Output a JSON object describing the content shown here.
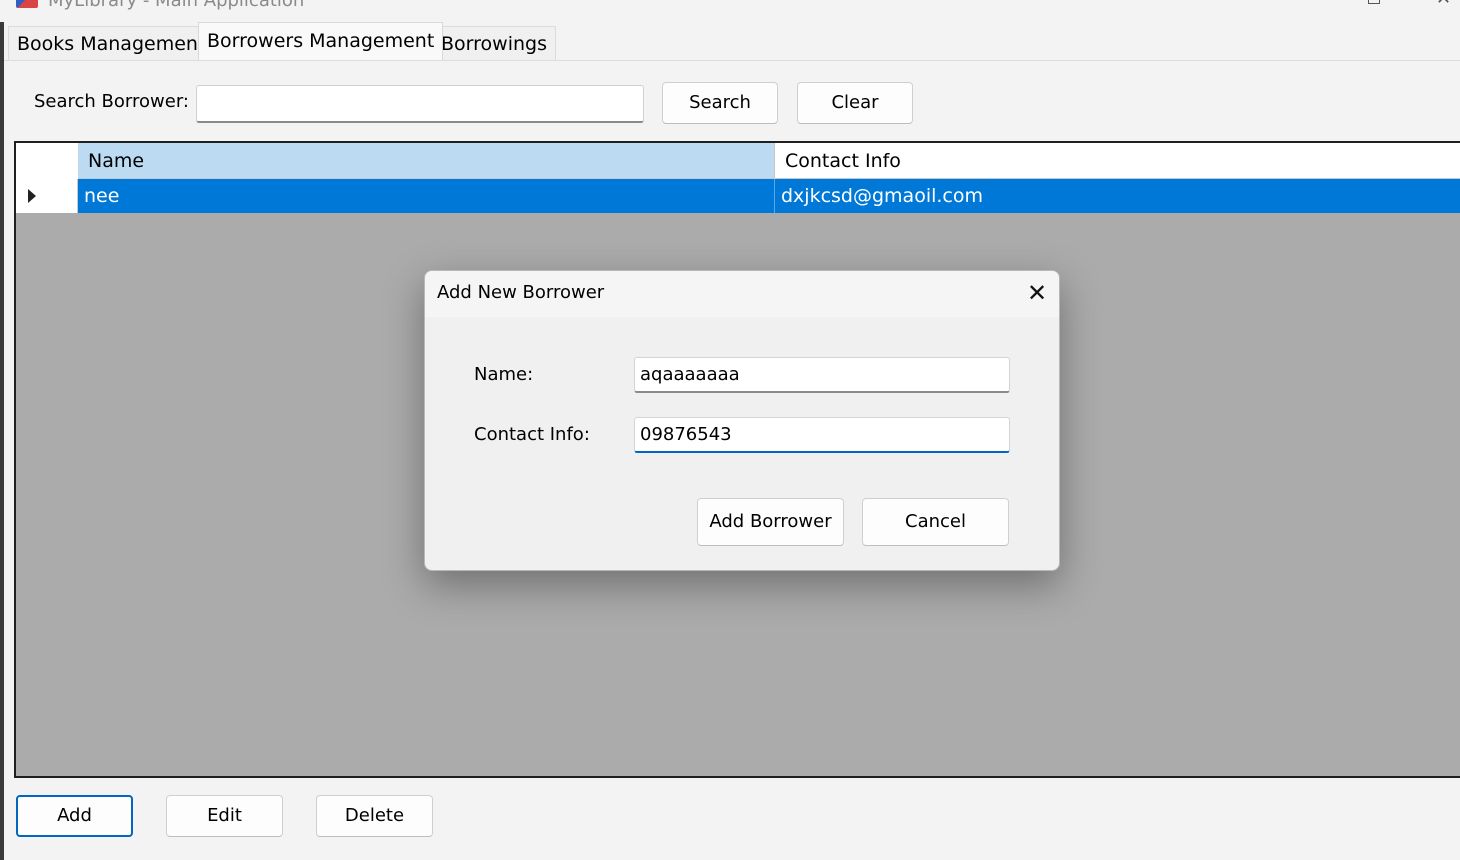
{
  "window": {
    "title": "MyLibrary - Main Application"
  },
  "tabs": [
    {
      "label": "Books Management",
      "selected": false
    },
    {
      "label": "Borrowers Management",
      "selected": true
    },
    {
      "label": "Borrowings",
      "selected": false
    }
  ],
  "search": {
    "label": "Search Borrower:",
    "value": "",
    "search_button": "Search",
    "clear_button": "Clear"
  },
  "grid": {
    "columns": [
      "Name",
      "Contact Info"
    ],
    "rows": [
      {
        "name": "nee",
        "contact": "dxjkcsd@gmaoil.com",
        "selected": true
      }
    ],
    "colors": {
      "selection": "#0078d7",
      "header_highlight": "#bcdaf2",
      "background": "#ababab"
    }
  },
  "dialog": {
    "title": "Add New Borrower",
    "name_label": "Name:",
    "name_value": "aqaaaaaaa",
    "contact_label": "Contact Info:",
    "contact_value": "09876543",
    "add_button": "Add Borrower",
    "cancel_button": "Cancel",
    "close_icon": "close-icon"
  },
  "actions": {
    "add": "Add",
    "edit": "Edit",
    "delete": "Delete"
  }
}
